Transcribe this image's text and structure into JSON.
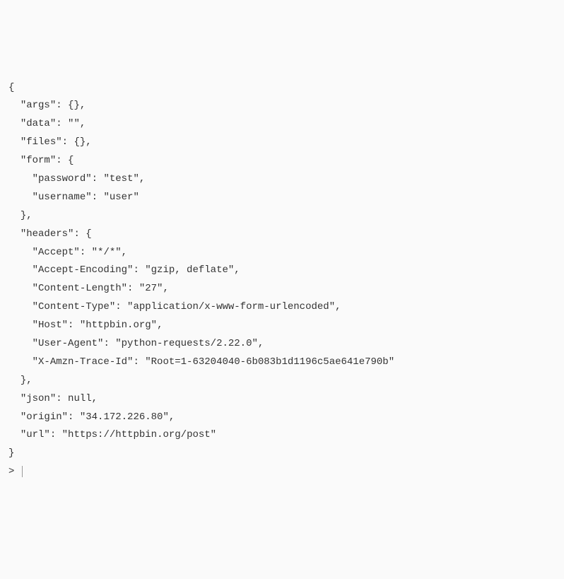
{
  "json_output": {
    "open_brace": "{",
    "args_key": "\"args\"",
    "args_val": "{}",
    "data_key": "\"data\"",
    "data_val": "\"\"",
    "files_key": "\"files\"",
    "files_val": "{}",
    "form_key": "\"form\"",
    "form_open": "{",
    "form_password_key": "\"password\"",
    "form_password_val": "\"test\"",
    "form_username_key": "\"username\"",
    "form_username_val": "\"user\"",
    "form_close": "}",
    "headers_key": "\"headers\"",
    "headers_open": "{",
    "headers_accept_key": "\"Accept\"",
    "headers_accept_val": "\"*/*\"",
    "headers_accept_encoding_key": "\"Accept-Encoding\"",
    "headers_accept_encoding_val": "\"gzip, deflate\"",
    "headers_content_length_key": "\"Content-Length\"",
    "headers_content_length_val": "\"27\"",
    "headers_content_type_key": "\"Content-Type\"",
    "headers_content_type_val": "\"application/x-www-form-urlencoded\"",
    "headers_host_key": "\"Host\"",
    "headers_host_val": "\"httpbin.org\"",
    "headers_user_agent_key": "\"User-Agent\"",
    "headers_user_agent_val": "\"python-requests/2.22.0\"",
    "headers_trace_id_key": "\"X-Amzn-Trace-Id\"",
    "headers_trace_id_val": "\"Root=1-63204040-6b083b1d1196c5ae641e790b\"",
    "headers_close": "}",
    "json_key": "\"json\"",
    "json_val": "null",
    "origin_key": "\"origin\"",
    "origin_val": "\"34.172.226.80\"",
    "url_key": "\"url\"",
    "url_val": "\"https://httpbin.org/post\"",
    "close_brace": "}"
  },
  "prompt": ">"
}
